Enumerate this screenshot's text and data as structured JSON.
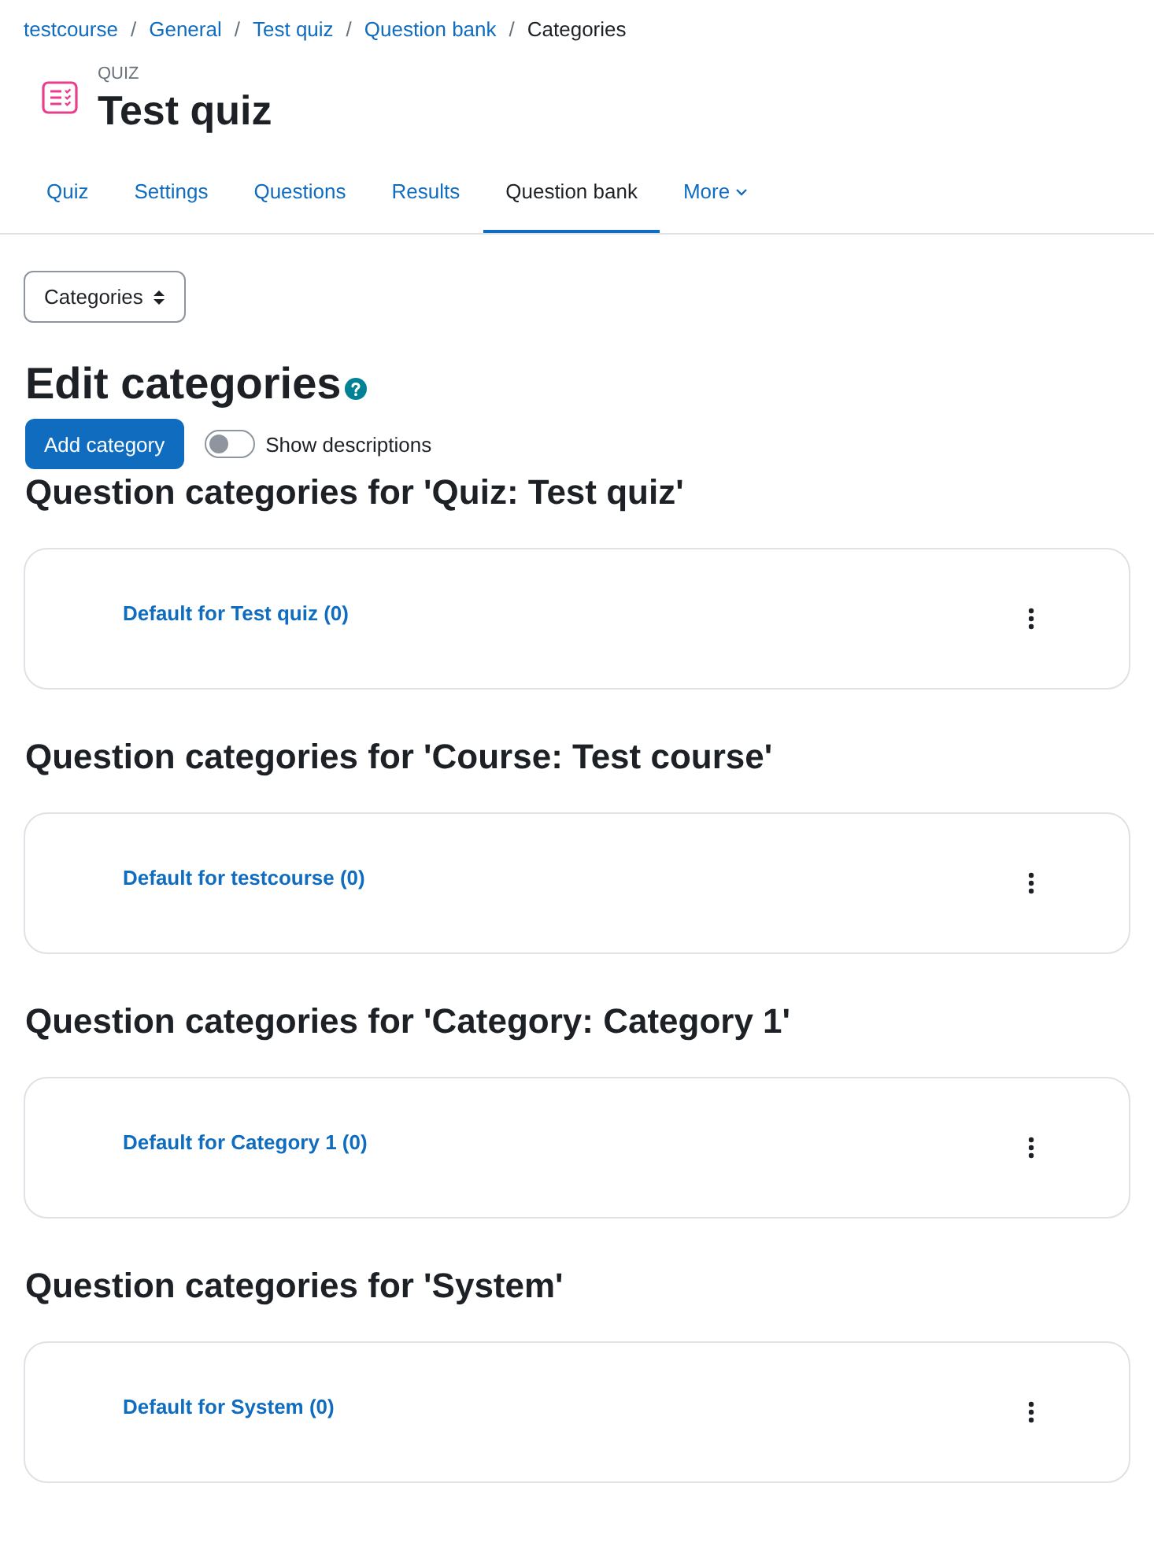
{
  "breadcrumb": [
    {
      "label": "testcourse",
      "kind": "link",
      "separator": "/"
    },
    {
      "label": "General",
      "kind": "link",
      "separator": "/"
    },
    {
      "label": "Test quiz",
      "kind": "link",
      "separator": "/"
    },
    {
      "label": "Question bank",
      "kind": "link",
      "separator": "/"
    },
    {
      "label": "Categories",
      "kind": "current"
    }
  ],
  "header": {
    "module_type": "QUIZ",
    "title": "Test quiz"
  },
  "tabs": [
    {
      "label": "Quiz",
      "kind": "link",
      "selected": false
    },
    {
      "label": "Settings",
      "kind": "link",
      "selected": false
    },
    {
      "label": "Questions",
      "kind": "link",
      "selected": false
    },
    {
      "label": "Results",
      "kind": "link",
      "selected": false
    },
    {
      "label": "Question bank",
      "kind": "link",
      "selected": true
    },
    {
      "label": "More",
      "kind": "dropdown",
      "selected": false
    }
  ],
  "page_select": {
    "value": "Categories"
  },
  "heading": "Edit categories",
  "add_button": "Add category",
  "show_descriptions": {
    "label": "Show descriptions",
    "on": false
  },
  "sections": [
    {
      "title": "Question categories for 'Quiz: Test quiz'",
      "categories": [
        {
          "label": "Default for Test quiz (0)"
        }
      ]
    },
    {
      "title": "Question categories for 'Course: Test course'",
      "categories": [
        {
          "label": "Default for testcourse (0)"
        }
      ]
    },
    {
      "title": "Question categories for 'Category: Category 1'",
      "categories": [
        {
          "label": "Default for Category 1 (0)"
        }
      ]
    },
    {
      "title": "Question categories for 'System'",
      "categories": [
        {
          "label": "Default for System (0)"
        }
      ]
    }
  ]
}
